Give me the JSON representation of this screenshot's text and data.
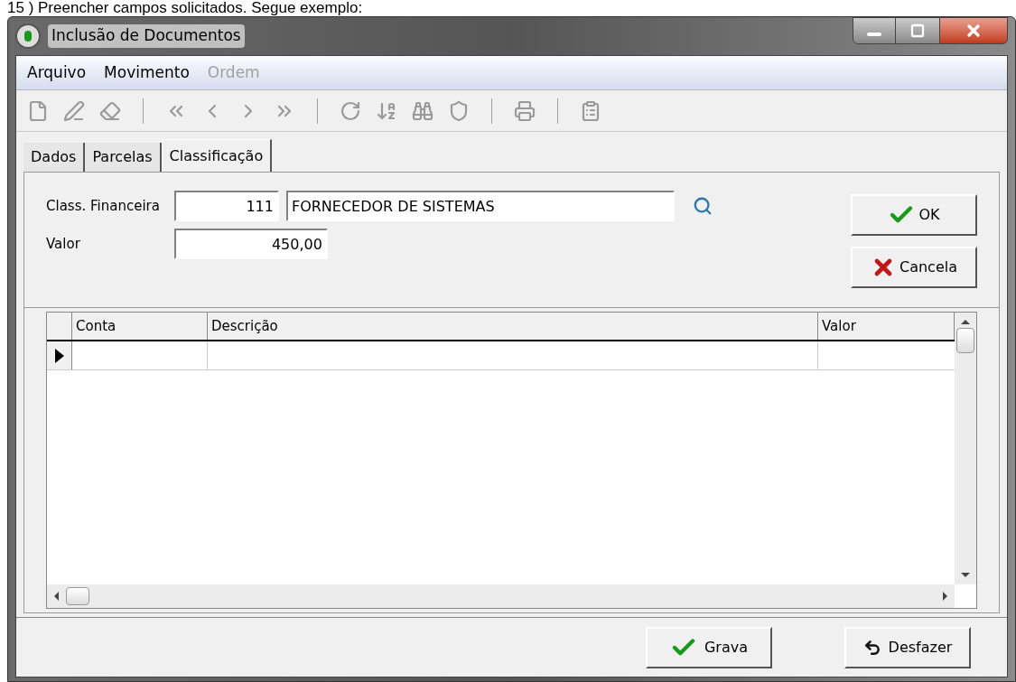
{
  "caption": "15 ) Preencher campos solicitados. Segue exemplo:",
  "window": {
    "title": "Inclusão de Documentos"
  },
  "menu": [
    {
      "label": "Arquivo",
      "disabled": false
    },
    {
      "label": "Movimento",
      "disabled": false
    },
    {
      "label": "Ordem",
      "disabled": true
    }
  ],
  "tabs": [
    {
      "label": "Dados",
      "selected": false
    },
    {
      "label": "Parcelas",
      "selected": false
    },
    {
      "label": "Classificação",
      "selected": true
    }
  ],
  "form": {
    "class_label": "Class. Financeira",
    "class_code": "111",
    "class_description": "FORNECEDOR DE SISTEMAS",
    "valor_label": "Valor",
    "valor": "450,00"
  },
  "side_buttons": [
    {
      "kind": "ok",
      "label": "OK"
    },
    {
      "kind": "cancel",
      "label": "Cancela"
    }
  ],
  "table": {
    "columns": [
      "Conta",
      "Descrição",
      "Valor"
    ],
    "current_row": true
  },
  "footer_buttons": [
    {
      "kind": "save",
      "label": "Grava"
    },
    {
      "kind": "undo",
      "label": "Desfazer"
    }
  ]
}
